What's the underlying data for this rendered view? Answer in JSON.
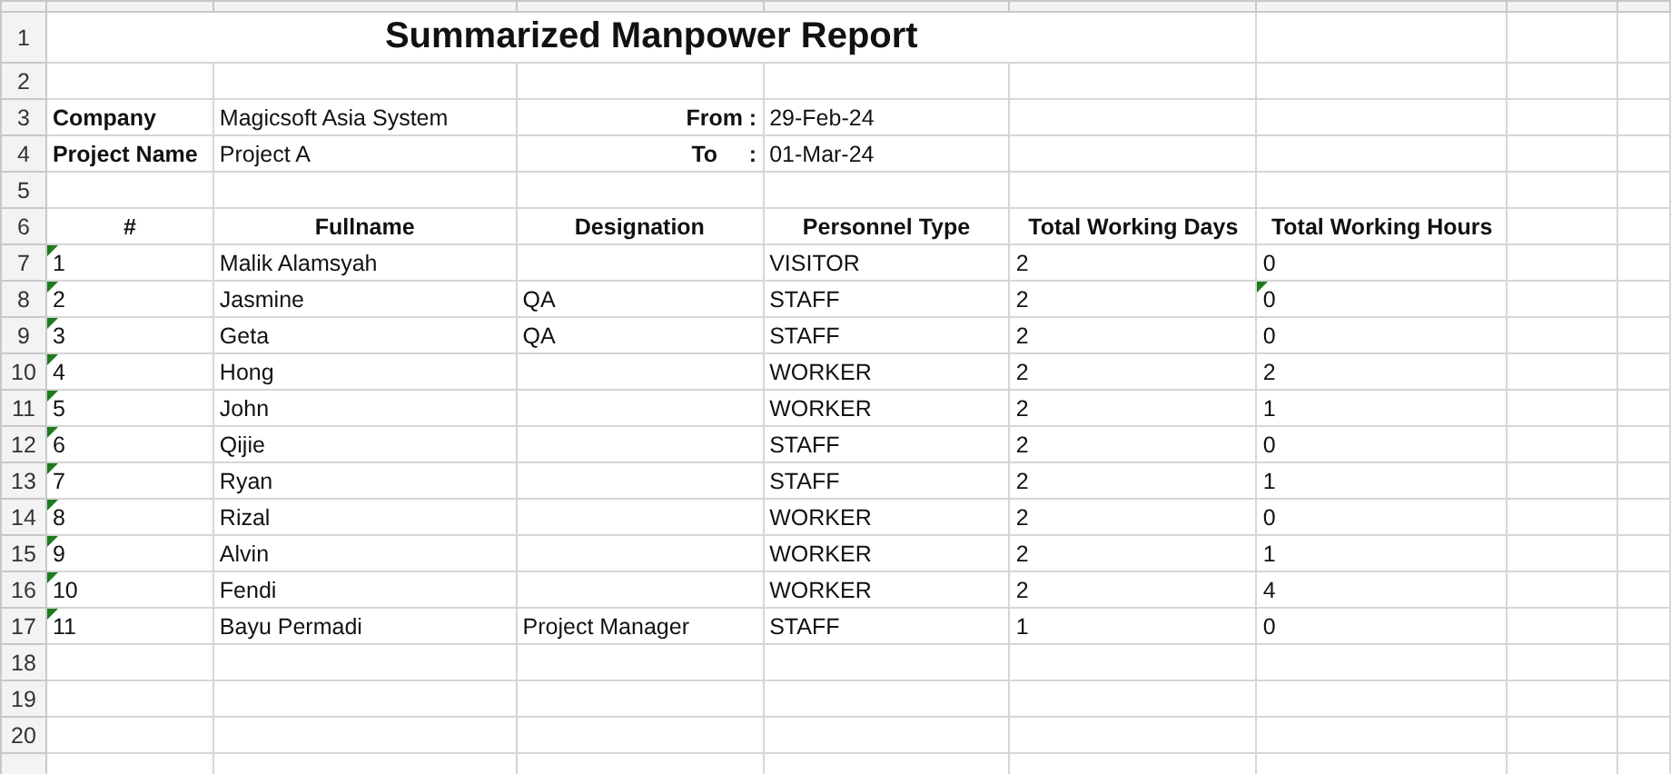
{
  "title": "Summarized Manpower Report",
  "info": [
    {
      "label": "Company",
      "value": "Magicsoft Asia System",
      "date_label": "From :",
      "date": "29-Feb-24"
    },
    {
      "label": "Project Name",
      "value": "Project A",
      "date_label": "To     :",
      "date": "01-Mar-24"
    }
  ],
  "columns": [
    "#",
    "Fullname",
    "Designation",
    "Personnel Type",
    "Total Working Days",
    "Total Working Hours"
  ],
  "rows": [
    {
      "number": "1",
      "fullname": "Malik Alamsyah",
      "designation": "",
      "personnel_type": "VISITOR",
      "days": "2",
      "hours": "0",
      "number_flagged": true,
      "hours_flagged": false
    },
    {
      "number": "2",
      "fullname": "Jasmine",
      "designation": "QA",
      "personnel_type": "STAFF",
      "days": "2",
      "hours": "0",
      "number_flagged": true,
      "hours_flagged": true
    },
    {
      "number": "3",
      "fullname": "Geta",
      "designation": "QA",
      "personnel_type": "STAFF",
      "days": "2",
      "hours": "0",
      "number_flagged": true,
      "hours_flagged": false
    },
    {
      "number": "4",
      "fullname": "Hong",
      "designation": "",
      "personnel_type": "WORKER",
      "days": "2",
      "hours": "2",
      "number_flagged": true,
      "hours_flagged": false
    },
    {
      "number": "5",
      "fullname": "John",
      "designation": "",
      "personnel_type": "WORKER",
      "days": "2",
      "hours": "1",
      "number_flagged": true,
      "hours_flagged": false
    },
    {
      "number": "6",
      "fullname": "Qijie",
      "designation": "",
      "personnel_type": "STAFF",
      "days": "2",
      "hours": "0",
      "number_flagged": true,
      "hours_flagged": false
    },
    {
      "number": "7",
      "fullname": "Ryan",
      "designation": "",
      "personnel_type": "STAFF",
      "days": "2",
      "hours": "1",
      "number_flagged": true,
      "hours_flagged": false
    },
    {
      "number": "8",
      "fullname": "Rizal",
      "designation": "",
      "personnel_type": "WORKER",
      "days": "2",
      "hours": "0",
      "number_flagged": true,
      "hours_flagged": false
    },
    {
      "number": "9",
      "fullname": "Alvin",
      "designation": "",
      "personnel_type": "WORKER",
      "days": "2",
      "hours": "1",
      "number_flagged": true,
      "hours_flagged": false
    },
    {
      "number": "10",
      "fullname": "Fendi",
      "designation": "",
      "personnel_type": "WORKER",
      "days": "2",
      "hours": "4",
      "number_flagged": true,
      "hours_flagged": false
    },
    {
      "number": "11",
      "fullname": "Bayu Permadi",
      "designation": "Project Manager",
      "personnel_type": "STAFF",
      "days": "1",
      "hours": "0",
      "number_flagged": true,
      "hours_flagged": false
    }
  ],
  "row_numbers": [
    "1",
    "2",
    "3",
    "4",
    "5",
    "6",
    "7",
    "8",
    "9",
    "10",
    "11",
    "12",
    "13",
    "14",
    "15",
    "16",
    "17",
    "18",
    "19",
    "20"
  ]
}
